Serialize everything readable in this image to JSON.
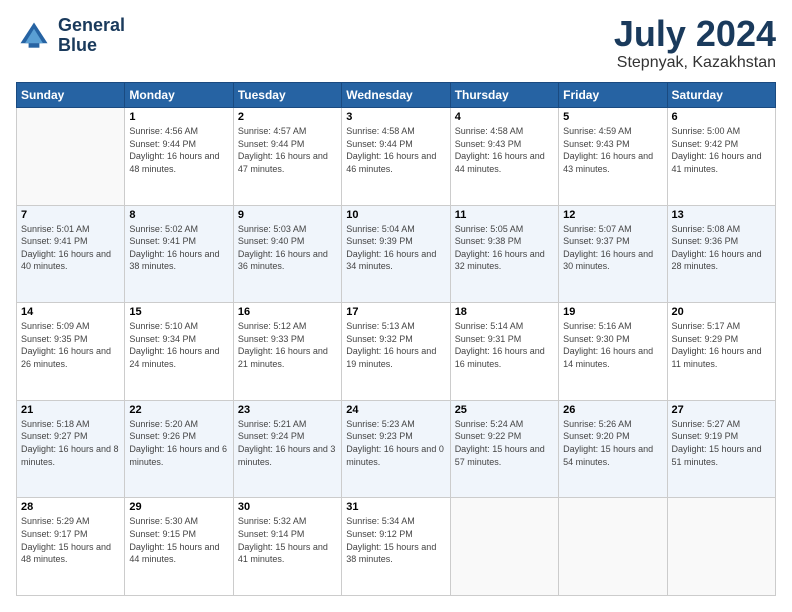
{
  "logo": {
    "line1": "General",
    "line2": "Blue"
  },
  "title": "July 2024",
  "subtitle": "Stepnyak, Kazakhstan",
  "weekdays": [
    "Sunday",
    "Monday",
    "Tuesday",
    "Wednesday",
    "Thursday",
    "Friday",
    "Saturday"
  ],
  "weeks": [
    [
      {
        "day": "",
        "sunrise": "",
        "sunset": "",
        "daylight": ""
      },
      {
        "day": "1",
        "sunrise": "Sunrise: 4:56 AM",
        "sunset": "Sunset: 9:44 PM",
        "daylight": "Daylight: 16 hours and 48 minutes."
      },
      {
        "day": "2",
        "sunrise": "Sunrise: 4:57 AM",
        "sunset": "Sunset: 9:44 PM",
        "daylight": "Daylight: 16 hours and 47 minutes."
      },
      {
        "day": "3",
        "sunrise": "Sunrise: 4:58 AM",
        "sunset": "Sunset: 9:44 PM",
        "daylight": "Daylight: 16 hours and 46 minutes."
      },
      {
        "day": "4",
        "sunrise": "Sunrise: 4:58 AM",
        "sunset": "Sunset: 9:43 PM",
        "daylight": "Daylight: 16 hours and 44 minutes."
      },
      {
        "day": "5",
        "sunrise": "Sunrise: 4:59 AM",
        "sunset": "Sunset: 9:43 PM",
        "daylight": "Daylight: 16 hours and 43 minutes."
      },
      {
        "day": "6",
        "sunrise": "Sunrise: 5:00 AM",
        "sunset": "Sunset: 9:42 PM",
        "daylight": "Daylight: 16 hours and 41 minutes."
      }
    ],
    [
      {
        "day": "7",
        "sunrise": "Sunrise: 5:01 AM",
        "sunset": "Sunset: 9:41 PM",
        "daylight": "Daylight: 16 hours and 40 minutes."
      },
      {
        "day": "8",
        "sunrise": "Sunrise: 5:02 AM",
        "sunset": "Sunset: 9:41 PM",
        "daylight": "Daylight: 16 hours and 38 minutes."
      },
      {
        "day": "9",
        "sunrise": "Sunrise: 5:03 AM",
        "sunset": "Sunset: 9:40 PM",
        "daylight": "Daylight: 16 hours and 36 minutes."
      },
      {
        "day": "10",
        "sunrise": "Sunrise: 5:04 AM",
        "sunset": "Sunset: 9:39 PM",
        "daylight": "Daylight: 16 hours and 34 minutes."
      },
      {
        "day": "11",
        "sunrise": "Sunrise: 5:05 AM",
        "sunset": "Sunset: 9:38 PM",
        "daylight": "Daylight: 16 hours and 32 minutes."
      },
      {
        "day": "12",
        "sunrise": "Sunrise: 5:07 AM",
        "sunset": "Sunset: 9:37 PM",
        "daylight": "Daylight: 16 hours and 30 minutes."
      },
      {
        "day": "13",
        "sunrise": "Sunrise: 5:08 AM",
        "sunset": "Sunset: 9:36 PM",
        "daylight": "Daylight: 16 hours and 28 minutes."
      }
    ],
    [
      {
        "day": "14",
        "sunrise": "Sunrise: 5:09 AM",
        "sunset": "Sunset: 9:35 PM",
        "daylight": "Daylight: 16 hours and 26 minutes."
      },
      {
        "day": "15",
        "sunrise": "Sunrise: 5:10 AM",
        "sunset": "Sunset: 9:34 PM",
        "daylight": "Daylight: 16 hours and 24 minutes."
      },
      {
        "day": "16",
        "sunrise": "Sunrise: 5:12 AM",
        "sunset": "Sunset: 9:33 PM",
        "daylight": "Daylight: 16 hours and 21 minutes."
      },
      {
        "day": "17",
        "sunrise": "Sunrise: 5:13 AM",
        "sunset": "Sunset: 9:32 PM",
        "daylight": "Daylight: 16 hours and 19 minutes."
      },
      {
        "day": "18",
        "sunrise": "Sunrise: 5:14 AM",
        "sunset": "Sunset: 9:31 PM",
        "daylight": "Daylight: 16 hours and 16 minutes."
      },
      {
        "day": "19",
        "sunrise": "Sunrise: 5:16 AM",
        "sunset": "Sunset: 9:30 PM",
        "daylight": "Daylight: 16 hours and 14 minutes."
      },
      {
        "day": "20",
        "sunrise": "Sunrise: 5:17 AM",
        "sunset": "Sunset: 9:29 PM",
        "daylight": "Daylight: 16 hours and 11 minutes."
      }
    ],
    [
      {
        "day": "21",
        "sunrise": "Sunrise: 5:18 AM",
        "sunset": "Sunset: 9:27 PM",
        "daylight": "Daylight: 16 hours and 8 minutes."
      },
      {
        "day": "22",
        "sunrise": "Sunrise: 5:20 AM",
        "sunset": "Sunset: 9:26 PM",
        "daylight": "Daylight: 16 hours and 6 minutes."
      },
      {
        "day": "23",
        "sunrise": "Sunrise: 5:21 AM",
        "sunset": "Sunset: 9:24 PM",
        "daylight": "Daylight: 16 hours and 3 minutes."
      },
      {
        "day": "24",
        "sunrise": "Sunrise: 5:23 AM",
        "sunset": "Sunset: 9:23 PM",
        "daylight": "Daylight: 16 hours and 0 minutes."
      },
      {
        "day": "25",
        "sunrise": "Sunrise: 5:24 AM",
        "sunset": "Sunset: 9:22 PM",
        "daylight": "Daylight: 15 hours and 57 minutes."
      },
      {
        "day": "26",
        "sunrise": "Sunrise: 5:26 AM",
        "sunset": "Sunset: 9:20 PM",
        "daylight": "Daylight: 15 hours and 54 minutes."
      },
      {
        "day": "27",
        "sunrise": "Sunrise: 5:27 AM",
        "sunset": "Sunset: 9:19 PM",
        "daylight": "Daylight: 15 hours and 51 minutes."
      }
    ],
    [
      {
        "day": "28",
        "sunrise": "Sunrise: 5:29 AM",
        "sunset": "Sunset: 9:17 PM",
        "daylight": "Daylight: 15 hours and 48 minutes."
      },
      {
        "day": "29",
        "sunrise": "Sunrise: 5:30 AM",
        "sunset": "Sunset: 9:15 PM",
        "daylight": "Daylight: 15 hours and 44 minutes."
      },
      {
        "day": "30",
        "sunrise": "Sunrise: 5:32 AM",
        "sunset": "Sunset: 9:14 PM",
        "daylight": "Daylight: 15 hours and 41 minutes."
      },
      {
        "day": "31",
        "sunrise": "Sunrise: 5:34 AM",
        "sunset": "Sunset: 9:12 PM",
        "daylight": "Daylight: 15 hours and 38 minutes."
      },
      {
        "day": "",
        "sunrise": "",
        "sunset": "",
        "daylight": ""
      },
      {
        "day": "",
        "sunrise": "",
        "sunset": "",
        "daylight": ""
      },
      {
        "day": "",
        "sunrise": "",
        "sunset": "",
        "daylight": ""
      }
    ]
  ]
}
